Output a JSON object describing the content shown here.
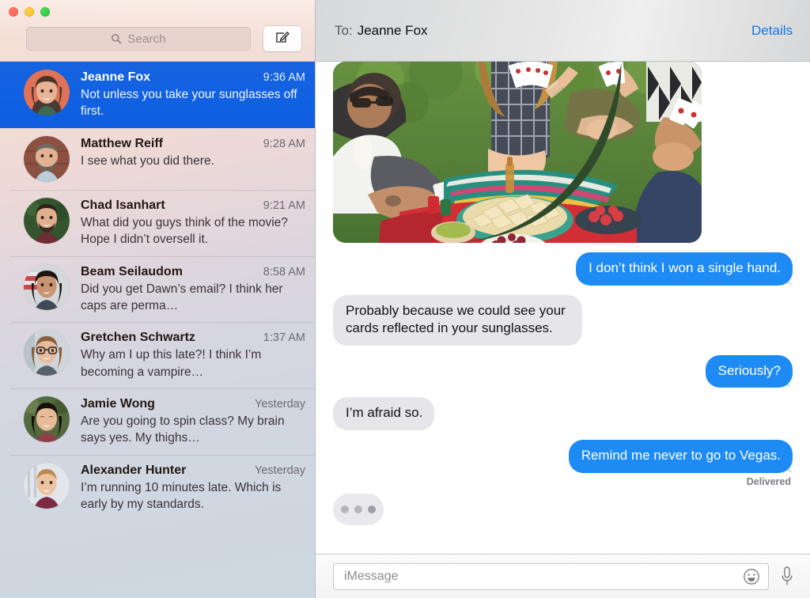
{
  "window": {
    "traffic_lights": [
      "close",
      "minimize",
      "maximize"
    ],
    "accent_blue": "#1e8bf5",
    "selected_row_blue": "#1161e3",
    "incoming_bubble_gray": "#e5e5ea"
  },
  "sidebar": {
    "search": {
      "placeholder": "Search",
      "value": "",
      "icon": "search-icon"
    },
    "compose": {
      "icon": "compose-icon",
      "label": ""
    },
    "conversations": [
      {
        "name": "Jeanne Fox",
        "time": "9:36 AM",
        "preview": "Not unless you take your sunglasses off first.",
        "selected": true,
        "avatar": "woman-brown-hair-red-wall"
      },
      {
        "name": "Matthew Reiff",
        "time": "9:28 AM",
        "preview": "I see what you did there.",
        "selected": false,
        "avatar": "man-beard-brick-wall"
      },
      {
        "name": "Chad Isanhart",
        "time": "9:21 AM",
        "preview": "What did you guys think of the movie? Hope I didn’t oversell it.",
        "selected": false,
        "avatar": "man-dark-hair-green-foliage"
      },
      {
        "name": "Beam Seilaudom",
        "time": "8:58 AM",
        "preview": "Did you get Dawn’s email? I think her caps are perma…",
        "selected": false,
        "avatar": "woman-dark-hair-flag"
      },
      {
        "name": "Gretchen Schwartz",
        "time": "1:37 AM",
        "preview": "Why am I up this late?! I think I’m becoming a vampire…",
        "selected": false,
        "avatar": "woman-glasses-light-background"
      },
      {
        "name": "Jamie Wong",
        "time": "Yesterday",
        "preview": "Are you going to spin class? My brain says yes. My thighs…",
        "selected": false,
        "avatar": "woman-black-hair-green-background"
      },
      {
        "name": "Alexander Hunter",
        "time": "Yesterday",
        "preview": "I’m running 10 minutes late. Which is early by my standards.",
        "selected": false,
        "avatar": "man-blond-maroon-shirt"
      }
    ]
  },
  "conversation": {
    "to_label": "To:",
    "to_name": "Jeanne Fox",
    "details_label": "Details",
    "messages": [
      {
        "type": "image",
        "direction": "in",
        "alt": "Friends sitting on a red picnic blanket outdoors playing cards with chips, guacamole, cherries and strawberries"
      },
      {
        "type": "text",
        "direction": "out",
        "text": "I don’t think I won a single hand."
      },
      {
        "type": "text",
        "direction": "in",
        "text": "Probably because we could see your cards reflected in your sunglasses."
      },
      {
        "type": "text",
        "direction": "out",
        "text": "Seriously?"
      },
      {
        "type": "text",
        "direction": "in",
        "text": "I’m afraid so."
      },
      {
        "type": "text",
        "direction": "out",
        "text": "Remind me never to go to Vegas."
      }
    ],
    "delivered_label": "Delivered",
    "typing_indicator": true
  },
  "compose": {
    "placeholder": "iMessage",
    "value": "",
    "emoji_icon": "smiley-icon",
    "mic_icon": "microphone-icon"
  }
}
